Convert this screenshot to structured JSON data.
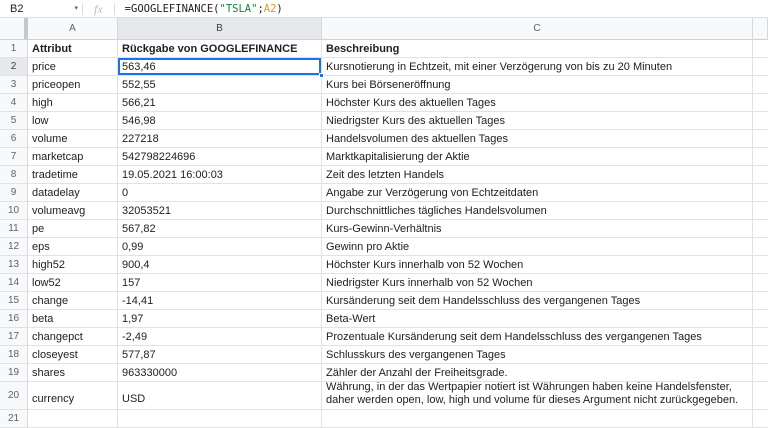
{
  "formula_bar": {
    "cell_reference": "B2",
    "dropdown_icon": "▾",
    "fx_icon": "fx",
    "formula": {
      "prefix": "=GOOGLEFINANCE(",
      "string_arg": "\"TSLA\"",
      "separator": ";",
      "cell_ref_arg": "A2",
      "suffix": ")"
    }
  },
  "colors": {
    "selection_blue": "#1a73e8",
    "formula_string_green": "#188038",
    "formula_ref_orange": "#e8971e"
  },
  "grid": {
    "column_letters": [
      "A",
      "B",
      "C"
    ],
    "selected_cell": "B2",
    "header_row": {
      "row_number": "1",
      "attr": "Attribut",
      "value": "Rückgabe von GOOGLEFINANCE",
      "desc": "Beschreibung"
    },
    "rows": [
      {
        "n": 2,
        "attr": "price",
        "value": "563,46",
        "desc": "Kursnotierung in Echtzeit, mit einer Verzögerung von bis zu 20 Minuten"
      },
      {
        "n": 3,
        "attr": "priceopen",
        "value": "552,55",
        "desc": "Kurs bei Börseneröffnung"
      },
      {
        "n": 4,
        "attr": "high",
        "value": "566,21",
        "desc": "Höchster Kurs des aktuellen Tages"
      },
      {
        "n": 5,
        "attr": "low",
        "value": "546,98",
        "desc": "Niedrigster Kurs des aktuellen Tages"
      },
      {
        "n": 6,
        "attr": "volume",
        "value": "227218",
        "desc": "Handelsvolumen des aktuellen Tages"
      },
      {
        "n": 7,
        "attr": "marketcap",
        "value": "542798224696",
        "desc": "Marktkapitalisierung der Aktie"
      },
      {
        "n": 8,
        "attr": "tradetime",
        "value": "19.05.2021 16:00:03",
        "desc": "Zeit des letzten Handels"
      },
      {
        "n": 9,
        "attr": "datadelay",
        "value": "0",
        "desc": "Angabe zur Verzögerung von Echtzeitdaten"
      },
      {
        "n": 10,
        "attr": "volumeavg",
        "value": "32053521",
        "desc": "Durchschnittliches tägliches Handelsvolumen"
      },
      {
        "n": 11,
        "attr": "pe",
        "value": "567,82",
        "desc": "Kurs-Gewinn-Verhältnis"
      },
      {
        "n": 12,
        "attr": "eps",
        "value": "0,99",
        "desc": "Gewinn pro Aktie"
      },
      {
        "n": 13,
        "attr": "high52",
        "value": "900,4",
        "desc": "Höchster Kurs innerhalb von 52 Wochen"
      },
      {
        "n": 14,
        "attr": "low52",
        "value": "157",
        "desc": "Niedrigster Kurs innerhalb von 52 Wochen"
      },
      {
        "n": 15,
        "attr": "change",
        "value": "-14,41",
        "desc": "Kursänderung seit dem Handelsschluss des vergangenen Tages"
      },
      {
        "n": 16,
        "attr": "beta",
        "value": "1,97",
        "desc": "Beta-Wert"
      },
      {
        "n": 17,
        "attr": "changepct",
        "value": "-2,49",
        "desc": "Prozentuale Kursänderung seit dem Handelsschluss des vergangenen Tages"
      },
      {
        "n": 18,
        "attr": "closeyest",
        "value": "577,87",
        "desc": "Schlusskurs des vergangenen Tages"
      },
      {
        "n": 19,
        "attr": "shares",
        "value": "963330000",
        "desc": "Zähler der Anzahl der Freiheitsgrade."
      },
      {
        "n": 20,
        "attr": "currency",
        "value": "USD",
        "desc": "Währung, in der das Wertpapier notiert ist Währungen haben keine Handelsfenster, daher werden open, low, high und volume für dieses Argument nicht zurückgegeben."
      },
      {
        "n": 21,
        "attr": "",
        "value": "",
        "desc": ""
      }
    ]
  }
}
